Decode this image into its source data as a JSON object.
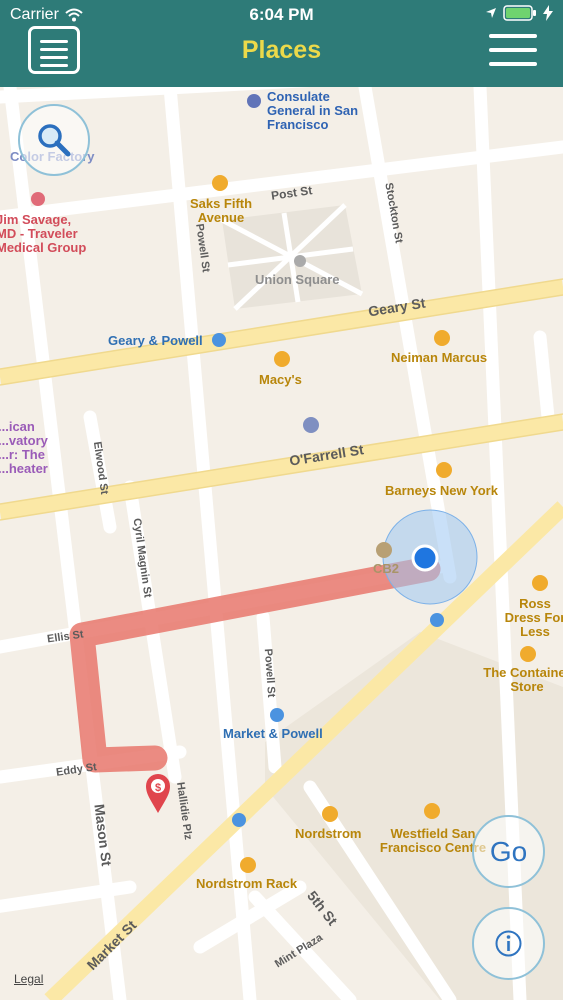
{
  "status_bar": {
    "carrier": "Carrier",
    "time": "6:04 PM"
  },
  "nav": {
    "title": "Places"
  },
  "map": {
    "streets": {
      "post": "Post St",
      "geary": "Geary St",
      "ofarrell": "O'Farrell St",
      "ellis": "Ellis St",
      "eddy": "Eddy St",
      "mason": "Mason St",
      "powell_top": "Powell St",
      "powell_bottom": "Powell St",
      "stockton": "Stockton St",
      "elwood": "Elwood St",
      "cyril": "Cyril Magnin St",
      "hallidie": "Hallidie Plz",
      "fifth": "5th St",
      "market": "Market St",
      "mint": "Mint Plaza"
    },
    "pois": {
      "consulate": "Consulate General in San Francisco",
      "color_factory": "Color Factory",
      "saks": "Saks Fifth Avenue",
      "union_square": "Union Square",
      "geary_powell": "Geary & Powell",
      "neiman": "Neiman Marcus",
      "macys": "Macy's",
      "barneys": "Barneys New York",
      "cb2": "CB2",
      "market_powell": "Market & Powell",
      "ross": "Ross Dress For Less",
      "container_store": "The Container Store",
      "nordstrom": "Nordstrom",
      "westfield": "Westfield San Francisco Centre",
      "nordstrom_rack": "Nordstrom Rack",
      "jim_savage": "Jim Savage, MD - Traveler Medical Group",
      "observatory": "...ican ...vatory ...r: The ...heater"
    }
  },
  "buttons": {
    "go": "Go"
  },
  "legal": "Legal",
  "icons": [
    "list-icon",
    "hamburger-menu-icon",
    "search-icon",
    "info-icon",
    "wifi-icon",
    "location-arrow-icon",
    "battery-icon",
    "charging-bolt-icon",
    "dollar-pin-icon",
    "user-location-icon"
  ],
  "colors": {
    "nav": "#2e7b78",
    "title": "#ecd94a",
    "route": "#e8776c",
    "accent": "#2f74c0"
  }
}
